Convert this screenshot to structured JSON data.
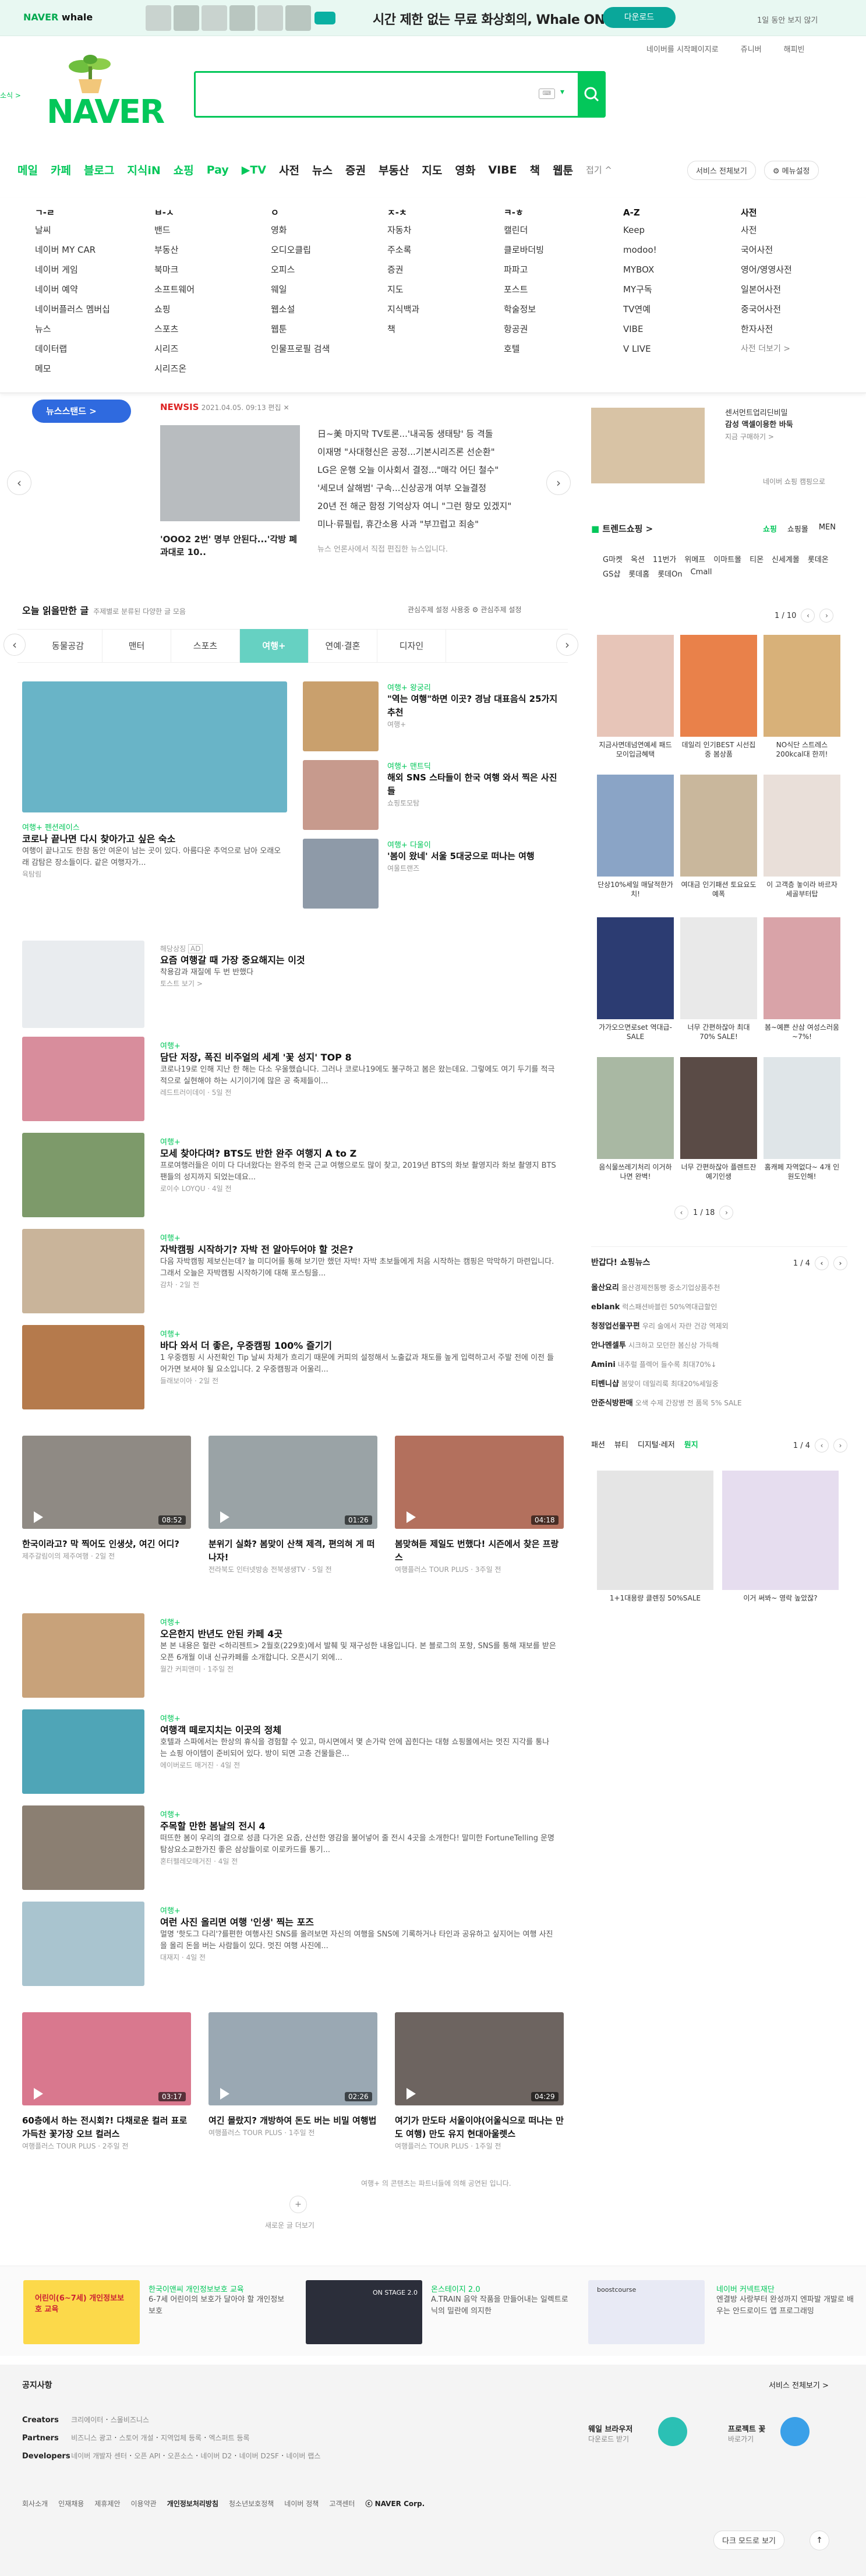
{
  "banner": {
    "brand": "NAVER",
    "brand2": "whale",
    "message": "시간 제한 없는 무료 화상회의, Whale ON!",
    "cta": "다운로드",
    "nolook": "1일 동안 보지 않기"
  },
  "util": {
    "home": "네이버를 시작페이지로",
    "jr": "쥬니버",
    "happy": "해피빈"
  },
  "search": {
    "placeholder": "",
    "kbd": "⌨"
  },
  "left_side": "소식 >",
  "nav": {
    "items": [
      "메일",
      "카페",
      "블로그",
      "지식iN",
      "쇼핑",
      "Pay",
      "▶TV",
      "사전",
      "뉴스",
      "증권",
      "부동산",
      "지도",
      "영화",
      "VIBE",
      "책",
      "웹툰"
    ],
    "more": "접기 ^",
    "all_services": "서비스 전체보기",
    "menu_settings": "⚙ 메뉴설정"
  },
  "services": {
    "cols": [
      {
        "h": "ㄱ-ㄹ",
        "items": [
          "날씨",
          "네이버 MY CAR",
          "네이버 게임",
          "네이버 예약",
          "네이버플러스 멤버십",
          "뉴스",
          "데이터랩",
          "메모"
        ]
      },
      {
        "h": "ㅂ-ㅅ",
        "items": [
          "밴드",
          "부동산",
          "북마크",
          "소프트웨어",
          "쇼핑",
          "스포츠",
          "시리즈",
          "시리즈온"
        ]
      },
      {
        "h": "ㅇ",
        "items": [
          "영화",
          "오디오클립",
          "오피스",
          "웨일",
          "웹소설",
          "웹툰",
          "인물프로필 검색"
        ]
      },
      {
        "h": "ㅈ-ㅊ",
        "items": [
          "자동차",
          "주소록",
          "증권",
          "지도",
          "지식백과",
          "책"
        ]
      },
      {
        "h": "ㅋ-ㅎ",
        "items": [
          "캘린더",
          "클로바더빙",
          "파파고",
          "포스트",
          "학술정보",
          "항공권",
          "호텔"
        ]
      },
      {
        "h": "A-Z",
        "items": [
          "Keep",
          "modoo!",
          "MYBOX",
          "MY구독",
          "TV연예",
          "VIBE",
          "V LIVE"
        ]
      },
      {
        "h": "사전",
        "items": [
          "사전",
          "국어사전",
          "영어/영영사전",
          "일본어사전",
          "중국어사전",
          "한자사전"
        ],
        "more": "사전 더보기 >"
      }
    ]
  },
  "news": {
    "button": "뉴스스탠드 >",
    "source": "NEWSIS",
    "date": "2021.04.05. 09:13 편집",
    "caption": "'OOO2 2번' 명부 안된다...'각방 폐과대로 10..",
    "headlines": [
      "日~美 마지막 TV토론...'내곡동 생태탕' 등 격돌",
      "이재명 \"사대형신은 공정...기본시리즈론 선순환\"",
      "LG은 운행 오늘 이사회서 결정...\"매각 어딘 철수\"",
      "'세모녀 살해범' 구속...신상공개 여부 오늘결정",
      "20년 전 해군 함정 기억상자 여니 \"그런 항모 있겠지\"",
      "미나·류필립, 휴간소용 사과 \"부끄럽고 죄송\""
    ],
    "note": "뉴스 언론사에서 직접 편집한 뉴스입니다."
  },
  "ad": {
    "text1": "센서먼트업리딘비밀",
    "text2": "감성 액셀이용한 바둑",
    "text3": "지금 구매하기 >",
    "foot": "네이버 쇼핑 캠핑으로"
  },
  "feed": {
    "title": "오늘 읽을만한 글",
    "sub": "주제별로 분류된 다양한 글 모음",
    "settings": "관심주제 설정 사용중   ⚙ 관심주제 설정",
    "tabs": [
      "동물공감",
      "맨터",
      "스포츠",
      "여행+",
      "연예·결혼",
      "디자인"
    ],
    "hero": {
      "tag": "여행+ 펜션레이스",
      "title": "코로나 끝나면 다시 찾아가고 싶은 숙소",
      "desc": "여행이 끝나고도 한참 동안 여운이 남는 곳이 있다. 아름다운 추억으로 남아 오래오래 감탐은 장소들이다. 같은 여행자가...",
      "meta": "육탐림"
    },
    "side": [
      {
        "tag": "여행+ 왕궁리",
        "title": "\"역는 여행\"하면 이곳? 경남 대표음식 25가지 추천",
        "meta": "여행+"
      },
      {
        "tag": "여행+ 맨트딕",
        "title": "해외 SNS 스타들이 한국 여행 와서 찍은 사진들",
        "meta": "쇼핑토모탐"
      },
      {
        "tag": "여행+ 다울이",
        "title": "'봄이 왔네' 서울 5대궁으로 떠나는 여행",
        "meta": "여울트랜즈"
      }
    ],
    "ad_item": {
      "label": "해당상징",
      "badge": "AD",
      "title": "요즘 여행갈 때 가장 중요해지는 이것",
      "desc": "착용감과 재질에 두 번 반했다",
      "meta": "토스트 보기 >"
    },
    "list": [
      {
        "tag": "여행+",
        "title": "담단 저장, 폭진 비주얼의 세계 '꽃 성지' TOP 8",
        "desc": "코로나19로 인해 지난 한 해는 다소 우울했습니다. 그러나 코로나19에도 불구하고 봄은 왔는데요. 그렇에도 여기 두기를 적극적으로 실현해야 하는 시기이기에 많은 공 축제들이...",
        "meta": "레드트러이데이 · 5일 전"
      },
      {
        "tag": "여행+",
        "title": "모세 찾아다며? BTS도 반한 완주 여행지 A to Z",
        "desc": "프로여행러들은 이미 다 다녀왔다는 완주의 한국 근교 여행으로도 많이 찾고, 2019년 BTS의 화보 촬영지라 화보 촬영지 BTS 팬들의 성지까지 되었는데요...",
        "meta": "로이수 LOYQU · 4일 전"
      },
      {
        "tag": "여행+",
        "title": "자박캠핑 시작하기? 자박 전 알아두어야 할 것은?",
        "desc": "다음 자박캠핑 제보신는데? 늘 미디어를 통해 보기만 했던 자박! 자박 초보들에게 처음 시작하는 캠핑은 막막하기 마련입니다. 그래서 오늘은 자박캠핑 시작하기에 대해 포스팅을...",
        "meta": "감차 · 2일 전"
      },
      {
        "tag": "여행+",
        "title": "바다 와서 더 좋은, 우중캠핑 100% 즐기기",
        "desc": "1 우중캠핑 시 사전확인 Tip 날씨 차체가 흐리기 때문에 커피의 설정해서 노출값과 채도를 높게 입력하고서 주발 전에 이전 들어가면 보셔야 될 요소입니다. 2 우중캠핑과 어울리...",
        "meta": "들래보이아 · 2일 전"
      }
    ],
    "videos1": [
      {
        "dur": "08:52",
        "title": "한국이라고? 막 찍어도 인생샷, 여긴 어디?",
        "meta": "제주갈림이의 제주여행 · 2일 전"
      },
      {
        "dur": "01:26",
        "title": "분위기 실화? 봄맞이 산책 제격, 편의혀 게 떠나자!",
        "meta": "전라북도 인터넷방송 전북생생TV · 5일 전"
      },
      {
        "dur": "04:18",
        "title": "봄맞혀듣 제일도 번했다! 시즌에서 찾은 프랑스",
        "meta": "여행플러스 TOUR PLUS · 3주일 전"
      }
    ],
    "list2": [
      {
        "tag": "여행+",
        "title": "오은한지 반년도 안된 카페 4곳",
        "desc": "본 본 내용은 혈란 <하리젠트> 2월호(229호)에서 발췌 및 재구성한 내용입니다. 본 블로그의 포항, SNS를 통해 재보를 받은 오픈 6개월 이내 신규카페를 소개합니다. 오픈시기 외에...",
        "meta": "월간 커피앤미 · 1주일 전"
      },
      {
        "tag": "여행+",
        "title": "여행객 떼로지치는 이곳의 정체",
        "desc": "호텔과 스파에서는 한상의 휴식을 경험할 수 있고, 마시면에서 몇 손가락 안에 꼽힌다는 대형 쇼핑몰에서는 멋진 지각를 통나는 쇼핑 아이템이 준비되어 있다. 방이 되면 고층 건물들은...",
        "meta": "에이버로드 매거진 · 4일 전"
      },
      {
        "tag": "여행+",
        "title": "주목할 만한 봄날의 전시 4",
        "desc": "떠뜨한 봄이 우리의 결으로 성큼 다가온 요즘, 산선한 영감을 불어넣어 줄 전시 4곳을 소개한다! 말미한 FortuneTelling 운명탐상요소교한가진 좋은 삼상들이로 이로카드를 통기...",
        "meta": "혼터펠레모매거진 · 4일 전"
      },
      {
        "tag": "여행+",
        "title": "여런 사진 올리면 여행 '인생' 찍는 포즈",
        "desc": "멀명 '핫도그 다리'?를편한 여행사진 SNS를 올려보면 자신의 여행을 SNS에 기록하거나 타인과 공유하고 싶지어는 여행 사진을 올리 돈을 버는 사람들이 있다. 멋진 여행 사진에...",
        "meta": "대재지 · 4일 전"
      }
    ],
    "videos2": [
      {
        "dur": "03:17",
        "title": "60층에서 하는 전시회?! 다채로운 컬러 표로 가득찬 꽃가장 오브 컬러스",
        "meta": "여행플러스 TOUR PLUS · 2주일 전"
      },
      {
        "dur": "02:26",
        "title": "여긴 몰랐지? 개방하여 돈도 버는 비밀 여행법",
        "meta": "여행플러스 TOUR PLUS · 1주일 전"
      },
      {
        "dur": "04:29",
        "title": "여기가 만도타 서울이야(어울식으로 떠나는 만도 여행) 만도 유지 현대아울렛스",
        "meta": "여행플러스 TOUR PLUS · 1주일 전"
      }
    ],
    "footnote": "여행+ 의 콘텐츠는 파트너들에 의해 공연된 입니다.",
    "more": "새로운 글 더보기"
  },
  "shopping": {
    "title": "트렌드쇼핑 >",
    "tabs": [
      "쇼핑",
      "쇼핑몰",
      "MEN"
    ],
    "keywords": [
      "G마켓",
      "옥션",
      "11번가",
      "위메프",
      "이마트몰",
      "티몬",
      "신세계몰",
      "롯데온",
      "GS샵",
      "롯데홈",
      "롯데On",
      "Cmall"
    ],
    "pager": "1 / 10",
    "products": [
      {
        "cap": "지금사면데넘연예세 패드모이입금혜택"
      },
      {
        "cap": "데일리 인기BEST 시선집중 봄상품"
      },
      {
        "cap": "NO식단 스트레스 200kcal대 한끼!"
      },
      {
        "cap": "단상10%세일 매달적한가치!"
      },
      {
        "cap": "여대금 인기패션 토요요도예폭"
      },
      {
        "cap": "이 고객층 놓이라 바르자세골부터탑"
      },
      {
        "cap": "가가오으면로set 역대급-SALE"
      },
      {
        "cap": "너무 간편하잖아 최대 70% SALE!"
      },
      {
        "cap": "봄~예쁜 산삼 여성스러움~7%!"
      },
      {
        "cap": "음식물쓰레기처리 이거하나면 완벽!"
      },
      {
        "cap": "너무 간편하잖아 플렌트잔예기인생"
      },
      {
        "cap": "홈캐페 자역없다~ 4개 인원도인해!"
      }
    ],
    "pager2": "1 / 18"
  },
  "brand_shop": {
    "title": "반갑다! 쇼핑뉴스",
    "pager": "1 / 4",
    "rows": [
      {
        "k": "올산요리",
        "v": "올산경제전통빵 중소기업상품추천"
      },
      {
        "k": "eblank",
        "v": "럭스패션바블린 50%역대급할인"
      },
      {
        "k": "청정업선물꾸편",
        "v": "우리 술에서 자란 건강 역제외"
      },
      {
        "k": "안나멘셀투",
        "v": "시크하고 모던한 봄신상 가득해"
      },
      {
        "k": "Amini",
        "v": "내추럴 플렉어 들수록 최대70%↓"
      },
      {
        "k": "티벤니샵",
        "v": "봄맞이 데일리룩 최대20%세일중"
      },
      {
        "k": "안준식방판매",
        "v": "오색 수제 간장병 전 품목 5% SALE"
      }
    ]
  },
  "beauty": {
    "tabs": [
      "패션",
      "뷰티",
      "디지털·레저",
      "뭔지"
    ],
    "pager": "1 / 4",
    "items": [
      {
        "cap": "1+1대용량 클렌징 50%SALE"
      },
      {
        "cap": "이거 써봐~ 영락 높았잖?"
      }
    ]
  },
  "promos": [
    {
      "title": "한국이앤씨 개인정보보호 교육",
      "desc": "6-7세 어린이의 보호가 달아야 할 개인정보보호",
      "badge": "어린이(6~7세) 개인정보보호 교육"
    },
    {
      "title": "온스테이지 2.0",
      "desc": "A.TRAIN 음악 작품을 만들어내는 일렉트로닉의 밀란에 의지한",
      "badge": "ON STAGE 2.0"
    },
    {
      "title": "네이버 커넥트재단",
      "desc": "엔결방 사랑부터 완성까지 엔파발 개발로 배우는 안드로이드 앱 프로그래밍",
      "badge": "boostcourse"
    }
  ],
  "footer": {
    "notice": "공지사항",
    "all_services": "서비스 전체보기 >",
    "creators_label": "Creators",
    "creators": [
      "크리에이터",
      "스몰비즈니스"
    ],
    "partners_label": "Partners",
    "partners": [
      "비즈니스 광고",
      "스토어 개설",
      "지역업체 등록",
      "엑스퍼트 등록"
    ],
    "developers_label": "Developers",
    "developers": [
      "네이버 개발자 센터",
      "오픈 API",
      "오픈소스",
      "네이버 D2",
      "네이버 D2SF",
      "네이버 랩스"
    ],
    "whale": {
      "title": "웨일 브라우저",
      "sub": "다운로드 받기"
    },
    "green": {
      "title": "프로젝트 꽃",
      "sub": "바로가기"
    },
    "links": [
      "회사소개",
      "인재채용",
      "제휴제안",
      "이용약관",
      "개인정보처리방침",
      "청소년보호정책",
      "네이버 정책",
      "고객센터"
    ],
    "copyright": "ⓒ NAVER Corp.",
    "darkmode": "다크 모드로 보기"
  }
}
